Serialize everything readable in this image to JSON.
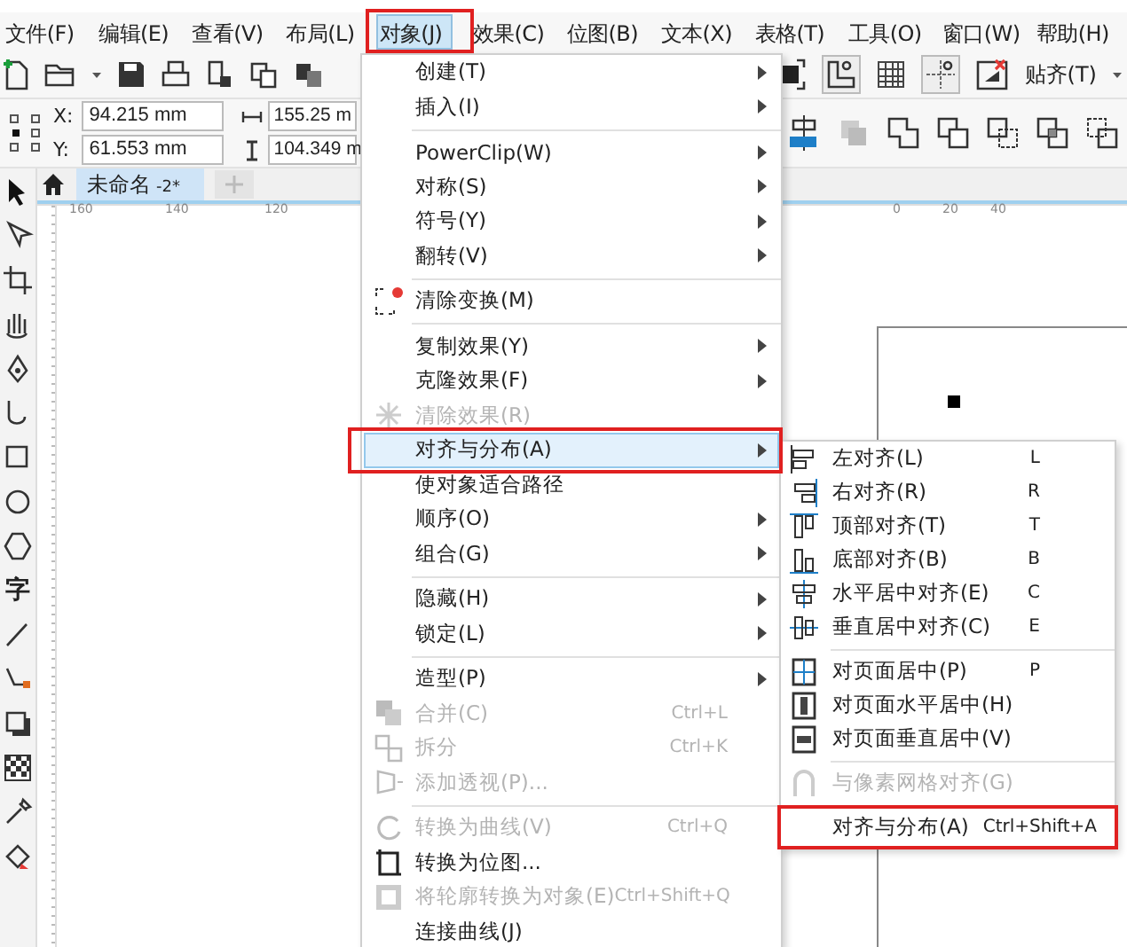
{
  "menubar": [
    {
      "label": "文件(F)",
      "selected": false,
      "highlighted": false
    },
    {
      "label": "编辑(E)",
      "selected": false,
      "highlighted": false
    },
    {
      "label": "查看(V)",
      "selected": false,
      "highlighted": false
    },
    {
      "label": "布局(L)",
      "selected": false,
      "highlighted": false
    },
    {
      "label": "对象(J)",
      "selected": true,
      "highlighted": true
    },
    {
      "label": "效果(C)",
      "selected": false,
      "highlighted": false
    },
    {
      "label": "位图(B)",
      "selected": false,
      "highlighted": false
    },
    {
      "label": "文本(X)",
      "selected": false,
      "highlighted": false
    },
    {
      "label": "表格(T)",
      "selected": false,
      "highlighted": false
    },
    {
      "label": "工具(O)",
      "selected": false,
      "highlighted": false
    },
    {
      "label": "窗口(W)",
      "selected": false,
      "highlighted": false
    },
    {
      "label": "帮助(H)",
      "selected": false,
      "highlighted": false
    }
  ],
  "toolbar": {
    "snap_label": "贴齐(T)"
  },
  "property_bar": {
    "x_label": "X:",
    "x_value": "94.215 mm",
    "y_label": "Y:",
    "y_value": "61.553 mm",
    "width_value": "155.25 m",
    "height_value": "104.349 m"
  },
  "document_tab": {
    "name": "未命名",
    "suffix": "-2*",
    "selected": true
  },
  "toolbox": {
    "text_tool_glyph": "字"
  },
  "ruler_labels": [
    "160",
    "140",
    "120",
    "0",
    "20",
    "40"
  ],
  "object_menu": [
    {
      "kind": "item",
      "label": "创建(T)",
      "submenu": true,
      "disabled": false,
      "selected": false,
      "highlighted": false
    },
    {
      "kind": "item",
      "label": "插入(I)",
      "submenu": true,
      "disabled": false,
      "selected": false,
      "highlighted": false
    },
    {
      "kind": "separator"
    },
    {
      "kind": "item",
      "label": "PowerClip(W)",
      "submenu": true,
      "disabled": false,
      "selected": false,
      "highlighted": false
    },
    {
      "kind": "item",
      "label": "对称(S)",
      "submenu": true,
      "disabled": false,
      "selected": false,
      "highlighted": false
    },
    {
      "kind": "item",
      "label": "符号(Y)",
      "submenu": true,
      "disabled": false,
      "selected": false,
      "highlighted": false
    },
    {
      "kind": "item",
      "label": "翻转(V)",
      "submenu": true,
      "disabled": false,
      "selected": false,
      "highlighted": false
    },
    {
      "kind": "separator"
    },
    {
      "kind": "item",
      "label": "清除变换(M)",
      "submenu": false,
      "disabled": false,
      "selected": false,
      "highlighted": false
    },
    {
      "kind": "separator"
    },
    {
      "kind": "item",
      "label": "复制效果(Y)",
      "submenu": true,
      "disabled": false,
      "selected": false,
      "highlighted": false
    },
    {
      "kind": "item",
      "label": "克隆效果(F)",
      "submenu": true,
      "disabled": false,
      "selected": false,
      "highlighted": false
    },
    {
      "kind": "item",
      "label": "清除效果(R)",
      "submenu": false,
      "disabled": true,
      "selected": false,
      "highlighted": false
    },
    {
      "kind": "item",
      "label": "对齐与分布(A)",
      "submenu": true,
      "disabled": false,
      "selected": true,
      "highlighted": true
    },
    {
      "kind": "item",
      "label": "使对象适合路径",
      "submenu": false,
      "disabled": false,
      "selected": false,
      "highlighted": false
    },
    {
      "kind": "item",
      "label": "顺序(O)",
      "submenu": true,
      "disabled": false,
      "selected": false,
      "highlighted": false
    },
    {
      "kind": "item",
      "label": "组合(G)",
      "submenu": true,
      "disabled": false,
      "selected": false,
      "highlighted": false
    },
    {
      "kind": "separator"
    },
    {
      "kind": "item",
      "label": "隐藏(H)",
      "submenu": true,
      "disabled": false,
      "selected": false,
      "highlighted": false
    },
    {
      "kind": "item",
      "label": "锁定(L)",
      "submenu": true,
      "disabled": false,
      "selected": false,
      "highlighted": false
    },
    {
      "kind": "separator"
    },
    {
      "kind": "item",
      "label": "造型(P)",
      "submenu": true,
      "disabled": false,
      "selected": false,
      "highlighted": false
    },
    {
      "kind": "item",
      "label": "合并(C)",
      "shortcut": "Ctrl+L",
      "submenu": false,
      "disabled": true,
      "selected": false,
      "highlighted": false
    },
    {
      "kind": "item",
      "label": "拆分",
      "shortcut": "Ctrl+K",
      "submenu": false,
      "disabled": true,
      "selected": false,
      "highlighted": false
    },
    {
      "kind": "item",
      "label": "添加透视(P)...",
      "submenu": false,
      "disabled": true,
      "selected": false,
      "highlighted": false
    },
    {
      "kind": "separator"
    },
    {
      "kind": "item",
      "label": "转换为曲线(V)",
      "shortcut": "Ctrl+Q",
      "submenu": false,
      "disabled": true,
      "selected": false,
      "highlighted": false
    },
    {
      "kind": "item",
      "label": "转换为位图...",
      "submenu": false,
      "disabled": false,
      "selected": false,
      "highlighted": false
    },
    {
      "kind": "item",
      "label": "将轮廓转换为对象(E)",
      "shortcut": "Ctrl+Shift+Q",
      "submenu": false,
      "disabled": true,
      "selected": false,
      "highlighted": false
    },
    {
      "kind": "item",
      "label": "连接曲线(J)",
      "submenu": false,
      "disabled": false,
      "selected": false,
      "highlighted": false
    }
  ],
  "align_submenu": [
    {
      "kind": "item",
      "label": "左对齐(L)",
      "shortcut": "L",
      "disabled": false,
      "selected": false,
      "highlighted": false
    },
    {
      "kind": "item",
      "label": "右对齐(R)",
      "shortcut": "R",
      "disabled": false,
      "selected": false,
      "highlighted": false
    },
    {
      "kind": "item",
      "label": "顶部对齐(T)",
      "shortcut": "T",
      "disabled": false,
      "selected": false,
      "highlighted": false
    },
    {
      "kind": "item",
      "label": "底部对齐(B)",
      "shortcut": "B",
      "disabled": false,
      "selected": false,
      "highlighted": false
    },
    {
      "kind": "item",
      "label": "水平居中对齐(E)",
      "shortcut": "C",
      "disabled": false,
      "selected": false,
      "highlighted": false
    },
    {
      "kind": "item",
      "label": "垂直居中对齐(C)",
      "shortcut": "E",
      "disabled": false,
      "selected": false,
      "highlighted": false
    },
    {
      "kind": "separator"
    },
    {
      "kind": "item",
      "label": "对页面居中(P)",
      "shortcut": "P",
      "disabled": false,
      "selected": false,
      "highlighted": false
    },
    {
      "kind": "item",
      "label": "对页面水平居中(H)",
      "disabled": false,
      "selected": false,
      "highlighted": false
    },
    {
      "kind": "item",
      "label": "对页面垂直居中(V)",
      "disabled": false,
      "selected": false,
      "highlighted": false
    },
    {
      "kind": "separator"
    },
    {
      "kind": "item",
      "label": "与像素网格对齐(G)",
      "disabled": true,
      "selected": false,
      "highlighted": false
    },
    {
      "kind": "separator"
    },
    {
      "kind": "item",
      "label": "对齐与分布(A)",
      "shortcut": "Ctrl+Shift+A",
      "disabled": false,
      "selected": false,
      "highlighted": true
    }
  ]
}
